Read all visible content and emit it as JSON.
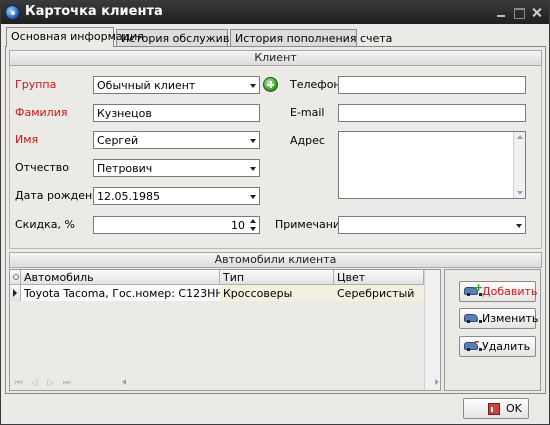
{
  "window": {
    "title": "Карточка клиента"
  },
  "tabs": [
    {
      "label": "Основная информация",
      "active": true
    },
    {
      "label": "История обслуживания",
      "active": false
    },
    {
      "label": "История пополнения счета",
      "active": false
    }
  ],
  "client": {
    "header": "Клиент",
    "group": {
      "label": "Группа",
      "value": "Обычный клиент"
    },
    "last_name": {
      "label": "Фамилия",
      "value": "Кузнецов"
    },
    "first_name": {
      "label": "Имя",
      "value": "Сергей"
    },
    "patronymic": {
      "label": "Отчество",
      "value": "Петрович"
    },
    "birth_date": {
      "label": "Дата рождения",
      "value": "12.05.1985"
    },
    "discount": {
      "label": "Скидка, %",
      "value": "10"
    },
    "phone": {
      "label": "Телефон",
      "value": ""
    },
    "email": {
      "label": "E-mail",
      "value": ""
    },
    "address": {
      "label": "Адрес",
      "value": ""
    },
    "note": {
      "label": "Примечание",
      "value": ""
    }
  },
  "cars": {
    "header": "Автомобили клиента",
    "columns": [
      "Автомобиль",
      "Тип",
      "Цвет"
    ],
    "rows": [
      {
        "car": "Toyota Tacoma, Гос.номер: С123НН",
        "type": "Кроссоверы",
        "color": "Серебристый"
      }
    ],
    "buttons": {
      "add": "Добавить",
      "edit": "Изменить",
      "delete": "Удалить"
    }
  },
  "footer": {
    "ok": "OK"
  },
  "colors": {
    "required_label": "#d01414",
    "selected_row": "#f3f0df",
    "titlebar": "#2a2a2a"
  }
}
